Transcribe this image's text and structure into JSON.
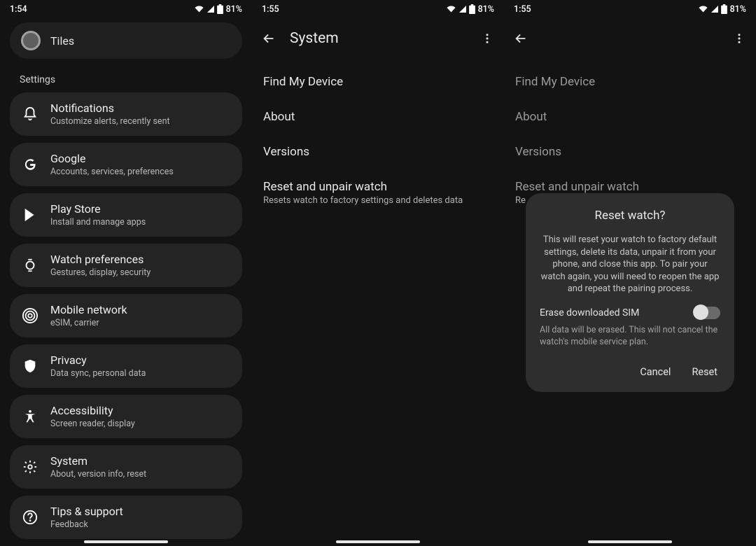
{
  "status": {
    "battery": "81%"
  },
  "screen1": {
    "time": "1:54",
    "tiles_label": "Tiles",
    "section_label": "Settings",
    "items": [
      {
        "title": "Notifications",
        "sub": "Customize alerts, recently sent"
      },
      {
        "title": "Google",
        "sub": "Accounts, services, preferences"
      },
      {
        "title": "Play Store",
        "sub": "Install and manage apps"
      },
      {
        "title": "Watch preferences",
        "sub": "Gestures, display, security"
      },
      {
        "title": "Mobile network",
        "sub": "eSIM, carrier"
      },
      {
        "title": "Privacy",
        "sub": "Data sync, personal data"
      },
      {
        "title": "Accessibility",
        "sub": "Screen reader, display"
      },
      {
        "title": "System",
        "sub": "About, version info, reset"
      },
      {
        "title": "Tips & support",
        "sub": "Feedback"
      }
    ]
  },
  "screen2": {
    "time": "1:55",
    "title": "System",
    "rows": [
      {
        "title": "Find My Device"
      },
      {
        "title": "About"
      },
      {
        "title": "Versions"
      },
      {
        "title": "Reset and unpair watch",
        "sub": "Resets watch to factory settings and deletes data"
      }
    ]
  },
  "screen3": {
    "time": "1:55",
    "rows": [
      {
        "title": "Find My Device"
      },
      {
        "title": "About"
      },
      {
        "title": "Versions"
      },
      {
        "title": "Reset and unpair watch",
        "sub": "Re"
      }
    ],
    "dialog": {
      "title": "Reset watch?",
      "body": "This will reset your watch to factory default settings, delete its data, unpair it from your phone, and close this app. To pair your watch again, you will need to reopen the app and repeat the pairing process.",
      "toggle_label": "Erase downloaded SIM",
      "note": "All data will be erased. This will not cancel the watch's mobile service plan.",
      "cancel": "Cancel",
      "confirm": "Reset"
    }
  }
}
